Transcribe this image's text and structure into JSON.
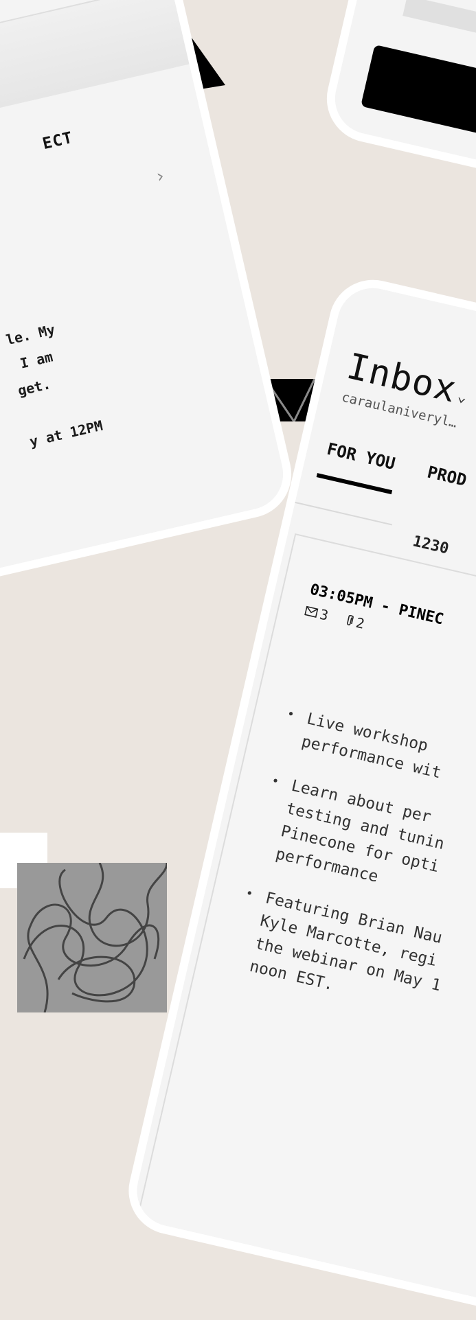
{
  "left_phone": {
    "subject": "ECT",
    "body": "le. My\n I am\nget.\n\ny at 12PM"
  },
  "main_phone": {
    "title": "Inbox",
    "account_email": "caraulaniveryl…",
    "tabs": [
      {
        "label": "FOR YOU",
        "selected": true
      },
      {
        "label": "PROD",
        "selected": false
      }
    ],
    "date_label": "1230",
    "email": {
      "header": "03:05PM - PINEC",
      "messages_count": "3",
      "attachments_count": "2",
      "bullets": [
        "Live workshop\nperformance wit",
        "Learn about per\ntesting and tunin\nPinecone for opti\nperformance",
        "Featuring Brian Nau\nKyle Marcotte, regi\nthe webinar on May 1\nnoon EST."
      ]
    }
  },
  "colors": {
    "background": "#ebe5df",
    "phone_body": "#f4f4f4",
    "phone_bezel": "#ffffff",
    "accent": "#000000",
    "squiggle_fill": "#999999"
  }
}
